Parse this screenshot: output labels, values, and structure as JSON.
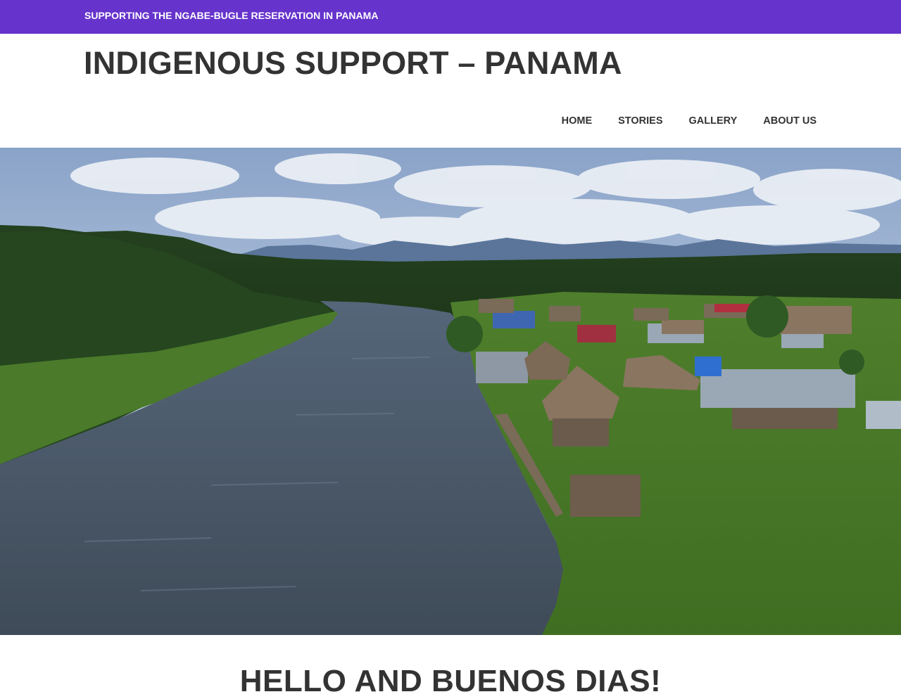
{
  "topbar": {
    "tagline": "SUPPORTING THE NGABE-BUGLE RESERVATION IN PANAMA",
    "color": "#6633cc"
  },
  "header": {
    "site_title": "INDIGENOUS SUPPORT – PANAMA"
  },
  "nav": {
    "items": [
      {
        "label": "HOME"
      },
      {
        "label": "STORIES"
      },
      {
        "label": "GALLERY"
      },
      {
        "label": "ABOUT US"
      }
    ]
  },
  "hero": {
    "image": "river-village-landscape"
  },
  "main": {
    "heading": "HELLO AND BUENOS DIAS!"
  }
}
